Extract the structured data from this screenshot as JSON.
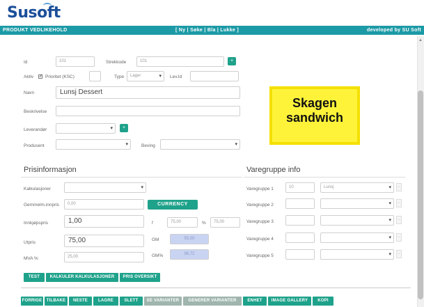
{
  "app": {
    "logo": "Susoft"
  },
  "topbar": {
    "title": "PRODUKT VEDLIKEHOLD",
    "menu": "[ Ny | Søke | Bla | Lukke ]",
    "developer": "developed by SU Soft"
  },
  "form": {
    "id_label": "Id",
    "id_value": "101",
    "strekkode_label": "Strekkode",
    "strekkode_value": "101",
    "aktiv_label": "Aktiv",
    "prioritet_label": "Prioritet (KSC)",
    "type_label": "Type",
    "type_value": "Lager",
    "lev_label": "Lev.Id",
    "navn_label": "Navn",
    "navn_value": "Lunsj Dessert",
    "beskrivelse_label": "Beskrivelse",
    "leverandor_label": "Leverandør",
    "produsent_label": "Produsent",
    "beving_label": "Beving"
  },
  "sticker": {
    "line1": "Skagen",
    "line2": "sandwich"
  },
  "pris": {
    "title": "Prisinformasjon",
    "kalkulasjon_label": "Kalkulasjoner",
    "innpris_label": "Gemmelm.innpris",
    "innpris_value": "0,00",
    "currency_button": "CURRENCY",
    "innkjopspris_label": "Innkjøpspris",
    "innkjopspris_value": "1,00",
    "f_label": "f",
    "f_value": "75,00",
    "pct_label": "%",
    "pct_value": "75,00",
    "utpris_label": "Utpris",
    "utpris_value": "75,00",
    "gm_label": "GM",
    "gm_value": "55,00",
    "mva_label": "MVA %",
    "mva_value": "25,00",
    "gmpct_label": "GM%",
    "gmpct_value": "98,72"
  },
  "varegruppe": {
    "title": "Varegruppe info",
    "rows": [
      {
        "label": "Varegruppe 1",
        "code": "10",
        "name": "Lunsj"
      },
      {
        "label": "Varegruppe 2",
        "code": "",
        "name": ""
      },
      {
        "label": "Varegruppe 3",
        "code": "",
        "name": ""
      },
      {
        "label": "Varegruppe 4",
        "code": "",
        "name": ""
      },
      {
        "label": "Varegruppe 5",
        "code": "",
        "name": ""
      }
    ],
    "minus": "−"
  },
  "mid_buttons": [
    "TEST",
    "KALKULER KALKULASJONER",
    "PRIS OVERSIKT"
  ],
  "bottom_buttons": [
    "FORRIGE",
    "TILBAKE",
    "NESTE",
    "LAGRE",
    "SLETT",
    "SE VARIANTER",
    "GENERER VARIANTER",
    "ENHET",
    "IMAGE GALLERY",
    "KOPI"
  ],
  "icons": {
    "checkbox_check": "✓",
    "chevron": "▾",
    "plus": "+",
    "scroll_up": "▲"
  },
  "colors": {
    "brand_blue": "#1c4f9a",
    "topbar_teal": "#1c9aa6",
    "button_green": "#1fa28b",
    "sticker_yellow": "#fff33a"
  }
}
